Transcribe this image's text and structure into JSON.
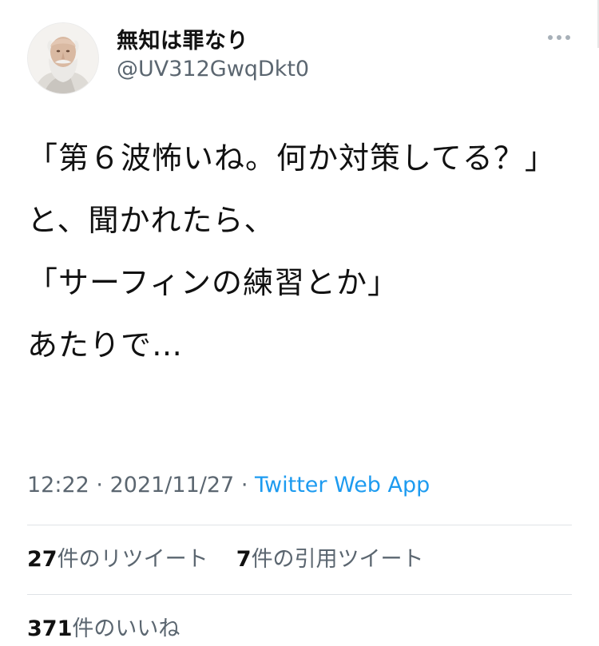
{
  "author": {
    "display_name": "無知は罪なり",
    "handle": "@UV312GwqDkt0",
    "avatar_icon": "socrates-bust-avatar"
  },
  "menu": {
    "icon": "more-horizontal-icon"
  },
  "tweet": {
    "paragraphs": [
      "「第６波怖いね。何か対策してる？」",
      "と、聞かれたら、",
      "「サーフィンの練習とか」",
      "あたりで…"
    ]
  },
  "meta": {
    "time": "12:22",
    "date": "2021/11/27",
    "separator": "·",
    "source": "Twitter Web App"
  },
  "stats": {
    "retweets_count": "27",
    "retweets_label": "件のリツイート",
    "quotes_count": "7",
    "quotes_label": "件の引用ツイート",
    "likes_count": "371",
    "likes_label": "件のいいね"
  },
  "colors": {
    "text": "#111111",
    "secondary": "#5b6670",
    "link": "#1d9bf0",
    "divider": "#dfe3e6"
  }
}
